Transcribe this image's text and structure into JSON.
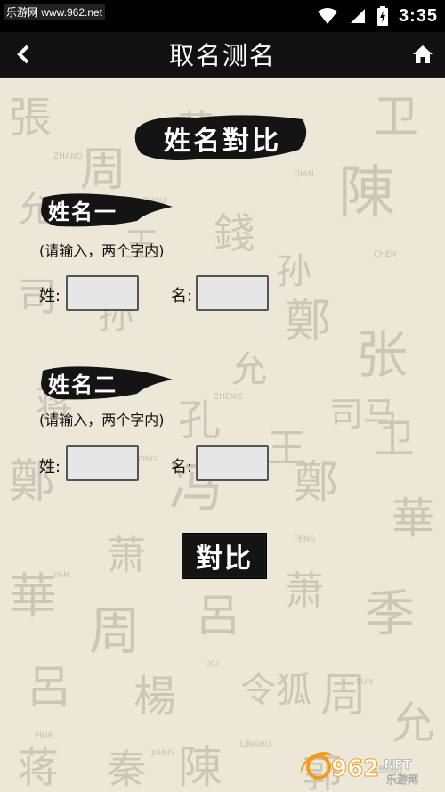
{
  "status_bar": {
    "watermark": "乐游网 www.962.net",
    "time": "3:35"
  },
  "app_bar": {
    "title": "取名测名"
  },
  "page": {
    "heading": "姓名對比",
    "section1": {
      "label": "姓名一",
      "hint": "(请输入，两个字内)",
      "surname_label": "姓:",
      "name_label": "名:",
      "surname_value": "",
      "name_value": ""
    },
    "section2": {
      "label": "姓名二",
      "hint": "(请输入，两个字内)",
      "surname_label": "姓:",
      "name_label": "名:",
      "surname_value": "",
      "name_value": ""
    },
    "compare_button": "對比"
  },
  "watermark_logo": {
    "brand": "962",
    "suffix": ".NET",
    "sub": "乐游网"
  },
  "colors": {
    "bar": "#111111",
    "paper": "#ece7d7",
    "ink": "#141414",
    "logo_orange": "#f39a1e"
  }
}
